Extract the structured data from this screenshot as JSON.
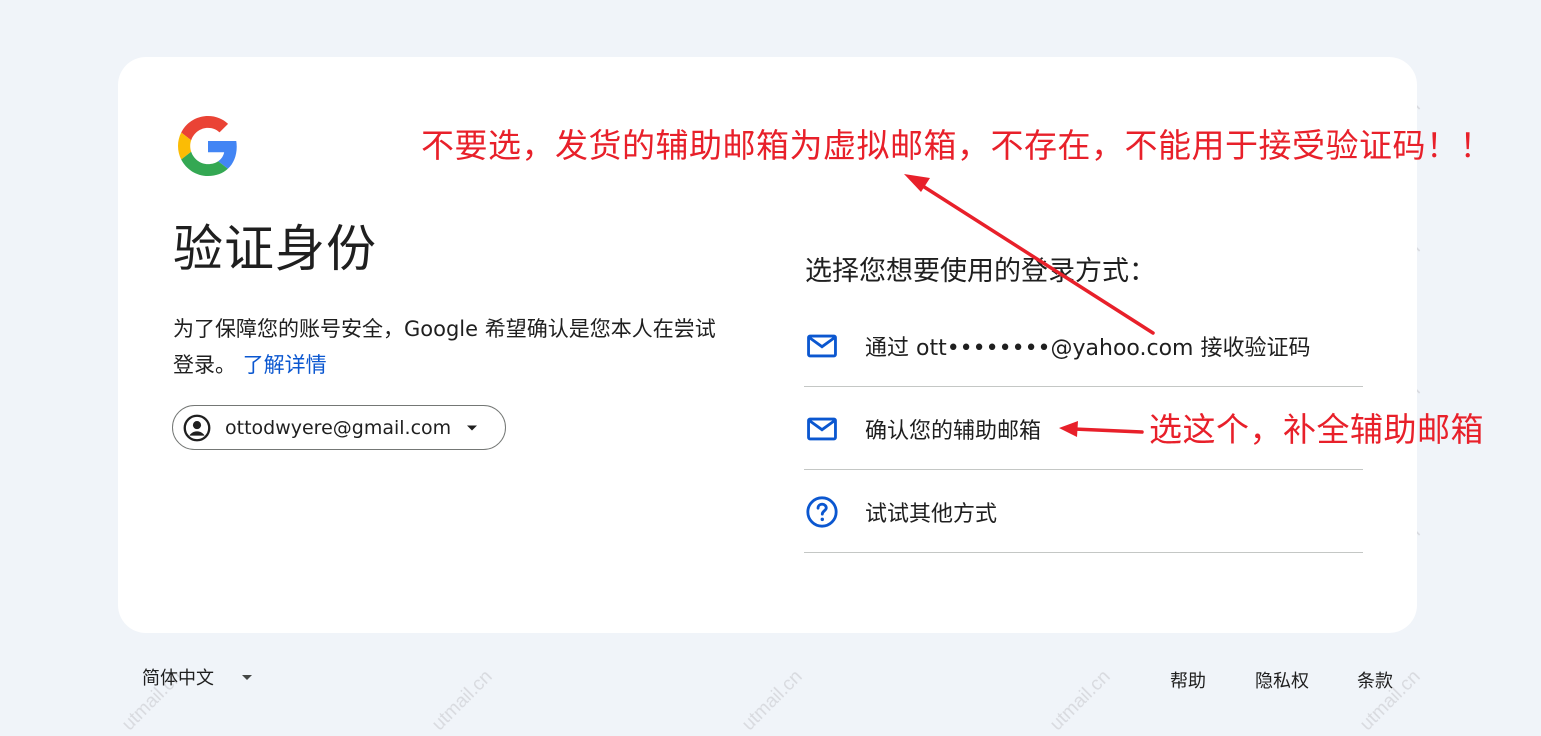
{
  "page": {
    "title": "验证身份",
    "description": "为了保障您的账号安全，Google 希望确认是您本人在尝试登录。",
    "learn_more": "了解详情"
  },
  "account": {
    "email": "ottodwyere@gmail.com"
  },
  "methods": {
    "label": "选择您想要使用的登录方式：",
    "options": [
      {
        "label": "通过 ott••••••••@yahoo.com 接收验证码",
        "icon": "mail-icon"
      },
      {
        "label": "确认您的辅助邮箱",
        "icon": "mail-icon"
      },
      {
        "label": "试试其他方式",
        "icon": "help-circle-icon"
      }
    ]
  },
  "footer": {
    "language": "简体中文",
    "help": "帮助",
    "privacy": "隐私权",
    "terms": "条款"
  },
  "annotations": {
    "top_note": "不要选，发货的辅助邮箱为虚拟邮箱，不存在，不能用于接受验证码！！",
    "side_note": "选这个，补全辅助邮箱",
    "color": "#e8202a"
  },
  "watermark": "utmail.cn",
  "colors": {
    "background": "#f0f4f9",
    "card": "#ffffff",
    "link": "#0b57d0",
    "icon": "#0b57d0"
  }
}
